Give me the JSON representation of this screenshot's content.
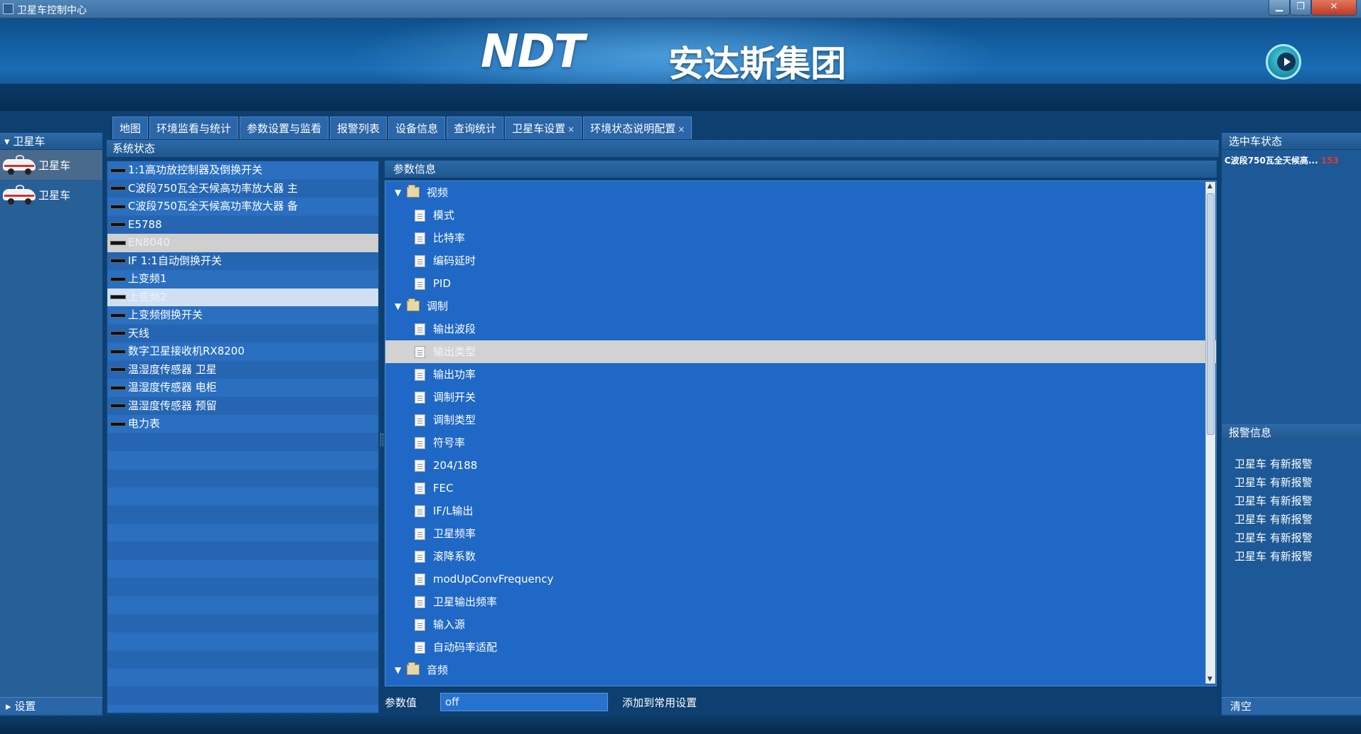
{
  "window": {
    "title": "卫星车控制中心",
    "min": "▁",
    "max": "❐",
    "close": "✕"
  },
  "banner": {
    "logo_text": "NDT",
    "company": "安达斯集团"
  },
  "tabs": [
    {
      "label": "地图"
    },
    {
      "label": "环境监看与统计"
    },
    {
      "label": "参数设置与监看"
    },
    {
      "label": "报警列表"
    },
    {
      "label": "设备信息"
    },
    {
      "label": "查询统计"
    },
    {
      "label": "卫星车设置",
      "close": "×"
    },
    {
      "label": "环境状态说明配置",
      "close": "×"
    }
  ],
  "left": {
    "header": "卫星车",
    "vehicles": [
      {
        "label": "卫星车"
      },
      {
        "label": "卫星车"
      }
    ],
    "footer": "设置"
  },
  "system_status": {
    "title": "系统状态"
  },
  "devices": [
    "1:1高功放控制器及倒换开关",
    "C波段750瓦全天候高功率放大器 主",
    "C波段750瓦全天候高功率放大器 备",
    "E5788",
    "EN8040",
    "IF 1:1自动倒换开关",
    "上变频1",
    "上变频2",
    "上变频倒换开关",
    "天线",
    "数字卫星接收机RX8200",
    "温湿度传感器 卫星",
    "温湿度传感器 电柜",
    "温湿度传感器 预留",
    "电力表"
  ],
  "params": {
    "title": "参数信息",
    "groups": [
      {
        "label": "视频",
        "items": [
          "模式",
          "比特率",
          "编码延时",
          "PID"
        ]
      },
      {
        "label": "调制",
        "items": [
          "输出波段",
          "输出类型",
          "输出功率",
          "调制开关",
          "调制类型",
          "符号率",
          "204/188",
          "FEC",
          "IF/L输出",
          "卫星频率",
          "滚降系数",
          "modUpConvFrequency",
          "卫星输出频率",
          "输入源",
          "自动码率适配"
        ]
      },
      {
        "label": "音频",
        "items": []
      }
    ],
    "selected_item": "输出类型",
    "value_label": "参数值",
    "value": "off",
    "add_label": "添加到常用设置"
  },
  "right": {
    "selected_header": "选中车状态",
    "selected_status_text": "C波段750瓦全天候高...",
    "selected_status_num": "153",
    "alarm_header": "报警信息",
    "alarms": [
      "卫星车 有新报警",
      "卫星车 有新报警",
      "卫星车 有新报警",
      "卫星车 有新报警",
      "卫星车 有新报警",
      "卫星车 有新报警"
    ],
    "clear_label": "清空"
  },
  "colors": {
    "accent": "#1f68c5",
    "selected_row": "#d2d2d2",
    "alert_number": "#e53a2a"
  }
}
